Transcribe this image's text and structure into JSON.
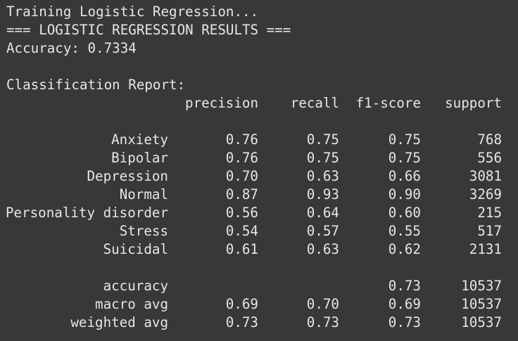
{
  "output": {
    "line1": "Training Logistic Regression...",
    "line2": "=== LOGISTIC REGRESSION RESULTS ===",
    "line3": "Accuracy: 0.7334",
    "line4": "Classification Report:"
  },
  "report": {
    "headers": {
      "precision": "precision",
      "recall": "recall",
      "f1": "f1-score",
      "support": "support"
    },
    "rows": [
      {
        "label": "Anxiety",
        "precision": "0.76",
        "recall": "0.75",
        "f1": "0.75",
        "support": "768"
      },
      {
        "label": "Bipolar",
        "precision": "0.76",
        "recall": "0.75",
        "f1": "0.75",
        "support": "556"
      },
      {
        "label": "Depression",
        "precision": "0.70",
        "recall": "0.63",
        "f1": "0.66",
        "support": "3081"
      },
      {
        "label": "Normal",
        "precision": "0.87",
        "recall": "0.93",
        "f1": "0.90",
        "support": "3269"
      },
      {
        "label": "Personality disorder",
        "precision": "0.56",
        "recall": "0.64",
        "f1": "0.60",
        "support": "215"
      },
      {
        "label": "Stress",
        "precision": "0.54",
        "recall": "0.57",
        "f1": "0.55",
        "support": "517"
      },
      {
        "label": "Suicidal",
        "precision": "0.61",
        "recall": "0.63",
        "f1": "0.62",
        "support": "2131"
      }
    ],
    "summary": [
      {
        "label": "accuracy",
        "precision": "",
        "recall": "",
        "f1": "0.73",
        "support": "10537"
      },
      {
        "label": "macro avg",
        "precision": "0.69",
        "recall": "0.70",
        "f1": "0.69",
        "support": "10537"
      },
      {
        "label": "weighted avg",
        "precision": "0.73",
        "recall": "0.73",
        "f1": "0.73",
        "support": "10537"
      }
    ]
  }
}
